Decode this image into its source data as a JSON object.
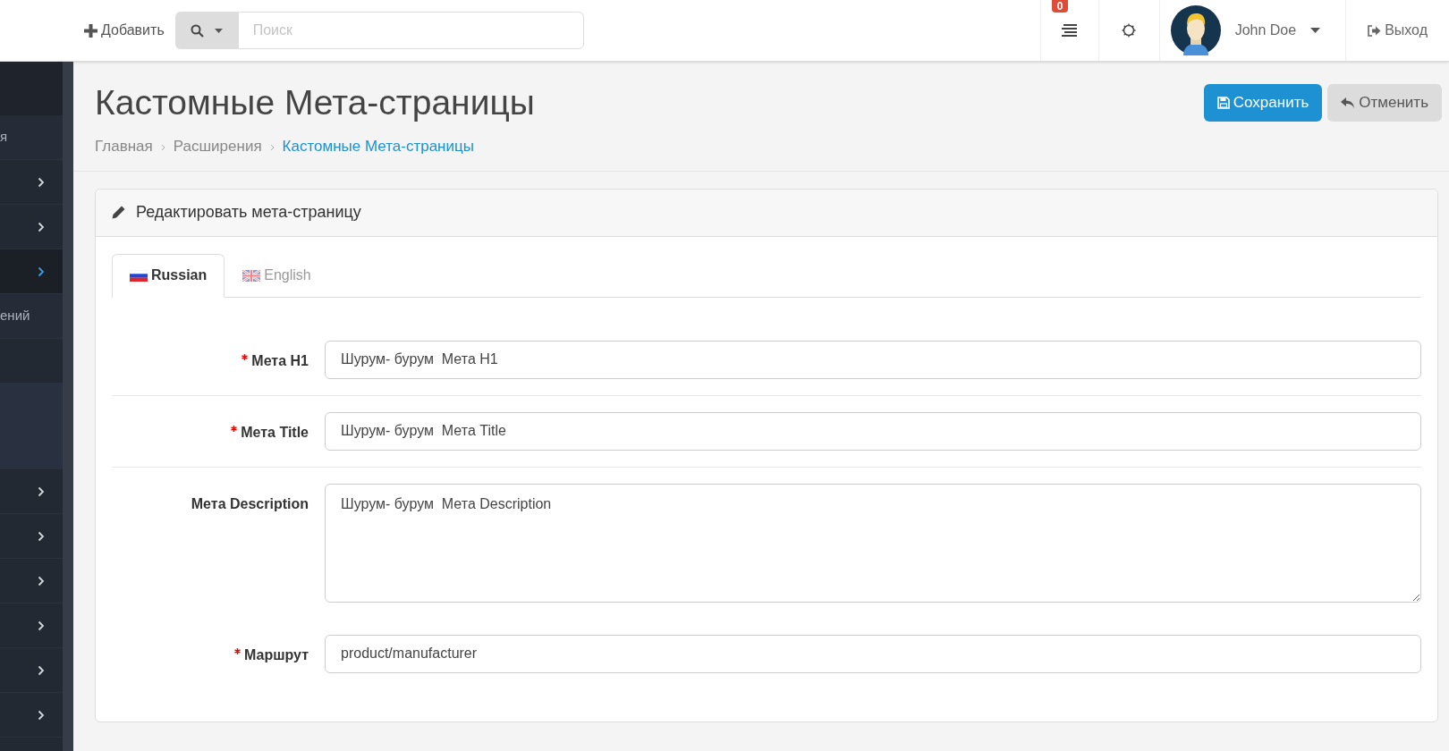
{
  "topbar": {
    "add_label": "Добавить",
    "search": {
      "placeholder": "Поиск"
    },
    "notifications": {
      "count": "0"
    },
    "user": {
      "name": "John Doe"
    },
    "logout": "Выход"
  },
  "sidebar": {
    "items": [
      {
        "kind": "header"
      },
      {
        "kind": "text",
        "label": "я",
        "selected": false
      },
      {
        "kind": "chevron",
        "selected": false
      },
      {
        "kind": "chevron",
        "selected": false
      },
      {
        "kind": "chevron",
        "selected": true
      },
      {
        "kind": "text",
        "label": "ений",
        "selected": false
      },
      {
        "kind": "tall",
        "selected": false
      },
      {
        "kind": "chevron",
        "selected": false
      },
      {
        "kind": "chevron",
        "selected": false
      },
      {
        "kind": "chevron",
        "selected": false
      },
      {
        "kind": "chevron",
        "selected": false
      },
      {
        "kind": "chevron",
        "selected": false
      },
      {
        "kind": "chevron",
        "selected": false
      }
    ]
  },
  "page": {
    "title": "Кастомные Мета-страницы",
    "breadcrumbs": [
      {
        "label": "Главная",
        "current": false
      },
      {
        "label": "Расширения",
        "current": false
      },
      {
        "label": "Кастомные Мета-страницы",
        "current": true
      }
    ],
    "buttons": [
      {
        "kind": "save",
        "label": "Сохранить"
      },
      {
        "kind": "cancel",
        "label": "Отменить"
      }
    ]
  },
  "panel": {
    "title": "Редактировать мета-страницу",
    "tabs": [
      {
        "label": "Russian",
        "kind": "ru",
        "selected": true
      },
      {
        "label": "English",
        "kind": "gb",
        "selected": false
      }
    ],
    "fields": [
      {
        "label": "Мета H1",
        "required": true,
        "kind": "input",
        "value": "Шурум- бурум  Мета H1"
      },
      {
        "label": "Мета Title",
        "required": true,
        "kind": "input",
        "value": "Шурум- бурум  Мета Title"
      },
      {
        "label": "Мета Description",
        "required": false,
        "kind": "textarea",
        "value": "Шурум- бурум  Мета Description"
      },
      {
        "label": "Маршрут",
        "required": true,
        "kind": "input",
        "value": "product/manufacturer"
      }
    ]
  }
}
